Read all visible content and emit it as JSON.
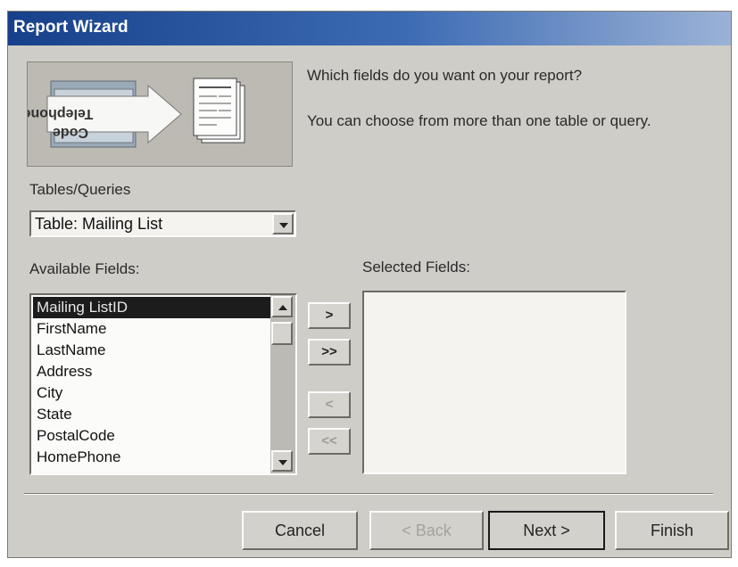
{
  "window": {
    "title": "Report Wizard"
  },
  "graphic": {
    "line1": "Telephone",
    "line2": "Code"
  },
  "prompt": {
    "question": "Which fields do you want on your report?",
    "hint": "You can choose from more than one table or query."
  },
  "tables_queries": {
    "label": "Tables/Queries",
    "value": "Table: Mailing List"
  },
  "available_fields": {
    "label": "Available Fields:",
    "items": [
      "Mailing ListID",
      "FirstName",
      "LastName",
      "Address",
      "City",
      "State",
      "PostalCode",
      "HomePhone"
    ],
    "selected_index": 0
  },
  "selected_fields": {
    "label": "Selected Fields:",
    "items": []
  },
  "move_buttons": {
    "add_one": ">",
    "add_all": ">>",
    "remove_one": "<",
    "remove_all": "<<"
  },
  "buttons": {
    "cancel": "Cancel",
    "back": "< Back",
    "next": "Next >",
    "finish": "Finish"
  },
  "colors": {
    "title_bar": "#17408a",
    "dialog_face": "#cfcdc8",
    "selection": "#1c1c1c"
  }
}
